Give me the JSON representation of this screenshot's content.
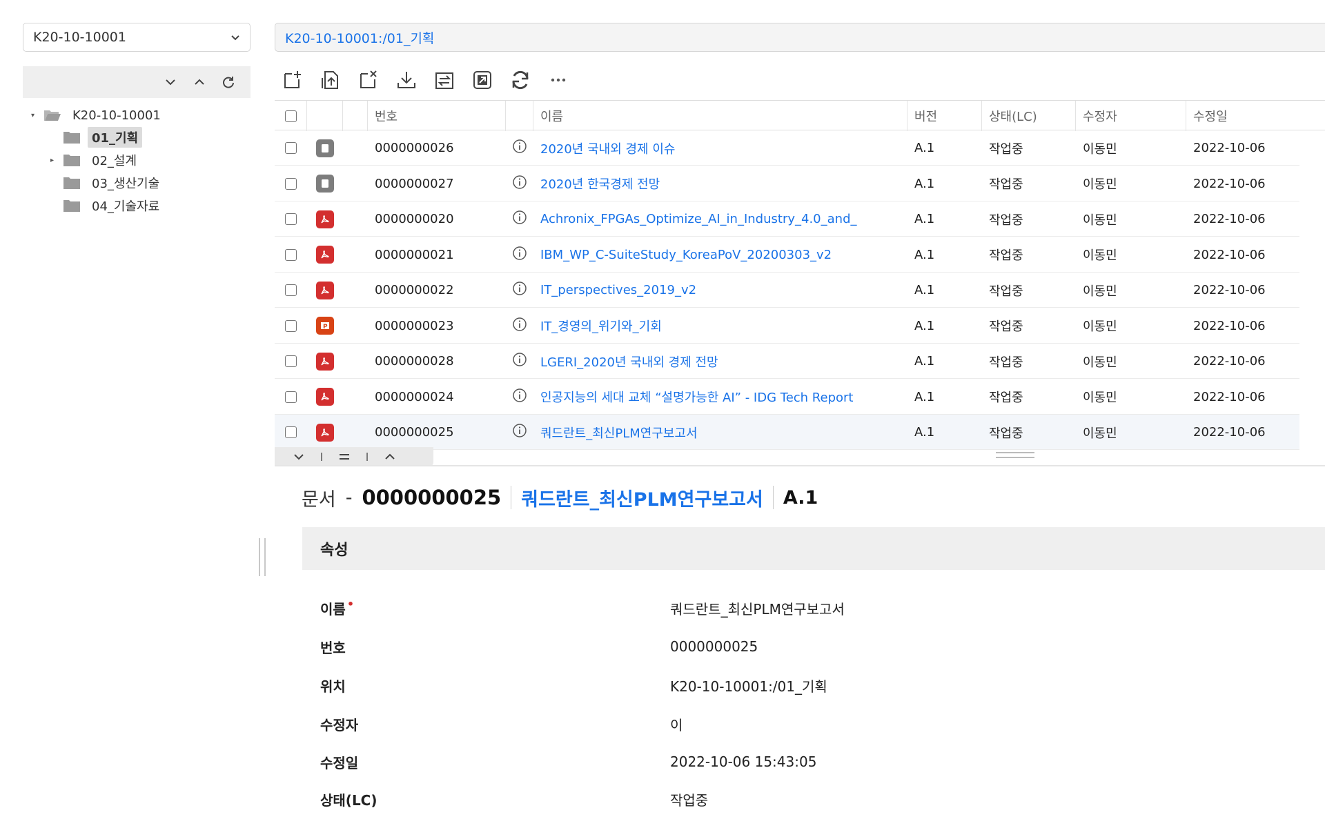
{
  "left": {
    "project_select": "K20-10-10001",
    "tree": [
      {
        "label": "K20-10-10001",
        "caret": "▾"
      },
      {
        "label": "01_기획",
        "caret": ""
      },
      {
        "label": "02_설계",
        "caret": "▸"
      },
      {
        "label": "03_생산기술",
        "caret": ""
      },
      {
        "label": "04_기술자료",
        "caret": ""
      }
    ]
  },
  "path": "K20-10-10001:/01_기획",
  "toolbar_icons": [
    "add-icon",
    "upload-icon",
    "remove-icon",
    "download-icon",
    "swap-icon",
    "open-external-icon",
    "refresh-icon",
    "more-icon"
  ],
  "grid": {
    "headers": {
      "number": "번호",
      "name": "이름",
      "version": "버전",
      "state": "상태(LC)",
      "modifier": "수정자",
      "modified": "수정일"
    },
    "rows": [
      {
        "type": "doc",
        "number": "0000000026",
        "name": "2020년 국내외 경제 이슈",
        "version": "A.1",
        "state": "작업중",
        "modifier": "이동민",
        "modified": "2022-10-06"
      },
      {
        "type": "doc",
        "number": "0000000027",
        "name": "2020년 한국경제 전망",
        "version": "A.1",
        "state": "작업중",
        "modifier": "이동민",
        "modified": "2022-10-06"
      },
      {
        "type": "pdf",
        "number": "0000000020",
        "name": "Achronix_FPGAs_Optimize_AI_in_Industry_4.0_and_",
        "version": "A.1",
        "state": "작업중",
        "modifier": "이동민",
        "modified": "2022-10-06"
      },
      {
        "type": "pdf",
        "number": "0000000021",
        "name": "IBM_WP_C-SuiteStudy_KoreaPoV_20200303_v2",
        "version": "A.1",
        "state": "작업중",
        "modifier": "이동민",
        "modified": "2022-10-06"
      },
      {
        "type": "pdf",
        "number": "0000000022",
        "name": "IT_perspectives_2019_v2",
        "version": "A.1",
        "state": "작업중",
        "modifier": "이동민",
        "modified": "2022-10-06"
      },
      {
        "type": "ppt",
        "number": "0000000023",
        "name": "IT_경영의_위기와_기회",
        "version": "A.1",
        "state": "작업중",
        "modifier": "이동민",
        "modified": "2022-10-06"
      },
      {
        "type": "pdf",
        "number": "0000000028",
        "name": "LGERI_2020년 국내외 경제 전망",
        "version": "A.1",
        "state": "작업중",
        "modifier": "이동민",
        "modified": "2022-10-06"
      },
      {
        "type": "pdf",
        "number": "0000000024",
        "name": "인공지능의 세대 교체 “설명가능한 AI” - IDG Tech Report",
        "version": "A.1",
        "state": "작업중",
        "modifier": "이동민",
        "modified": "2022-10-06"
      },
      {
        "type": "pdf",
        "number": "0000000025",
        "name": "쿼드란트_최신PLM연구보고서",
        "version": "A.1",
        "state": "작업중",
        "modifier": "이동민",
        "modified": "2022-10-06"
      }
    ]
  },
  "detail": {
    "kind": "문서",
    "dash": "-",
    "number": "0000000025",
    "name": "쿼드란트_최신PLM연구보고서",
    "version": "A.1",
    "section": "속성",
    "required_mark": "•",
    "properties": [
      {
        "label": "이름",
        "value": "쿼드란트_최신PLM연구보고서"
      },
      {
        "label": "번호",
        "value": "0000000025"
      },
      {
        "label": "위치",
        "value": "K20-10-10001:/01_기획"
      },
      {
        "label": "수정자",
        "value": "이"
      },
      {
        "label": "수정일",
        "value": "2022-10-06 15:43:05"
      },
      {
        "label": "상태(LC)",
        "value": "작업중"
      }
    ]
  },
  "colors": {
    "link": "#1a73e8",
    "pdf": "#d32f2f",
    "ppt": "#d84315",
    "doc": "#7d7d7d",
    "required": "#d32f2f"
  }
}
